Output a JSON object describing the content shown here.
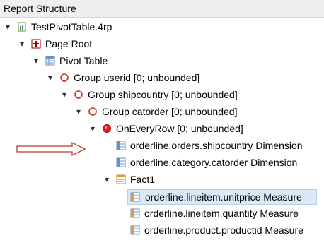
{
  "panel": {
    "title": "Report Structure"
  },
  "tree": [
    {
      "label": "TestPivotTable.4rp",
      "icon": "report-file-icon"
    },
    {
      "label": "Page Root",
      "icon": "page-root-icon"
    },
    {
      "label": "Pivot Table",
      "icon": "pivot-table-icon"
    },
    {
      "label": "Group userid [0; unbounded]",
      "icon": "group-circle-icon"
    },
    {
      "label": "Group shipcountry [0; unbounded]",
      "icon": "group-circle-icon"
    },
    {
      "label": "Group catorder [0; unbounded]",
      "icon": "group-circle-icon"
    },
    {
      "label": "OnEveryRow [0; unbounded]",
      "icon": "on-every-row-icon"
    },
    {
      "label": "orderline.orders.shipcountry Dimension",
      "icon": "dimension-icon"
    },
    {
      "label": "orderline.category.catorder Dimension",
      "icon": "dimension-icon"
    },
    {
      "label": "Fact1",
      "icon": "fact-icon"
    },
    {
      "label": "orderline.lineitem.unitprice Measure",
      "icon": "measure-icon",
      "selected": true
    },
    {
      "label": "orderline.lineitem.quantity Measure",
      "icon": "measure-icon"
    },
    {
      "label": "orderline.product.productid Measure",
      "icon": "measure-icon"
    }
  ],
  "colors": {
    "header_bg": "#efefef",
    "selection": "#dbe9f7",
    "arrow": "#c0392b",
    "group_circle": "#c0392b",
    "on_every_row": "#e02020"
  }
}
